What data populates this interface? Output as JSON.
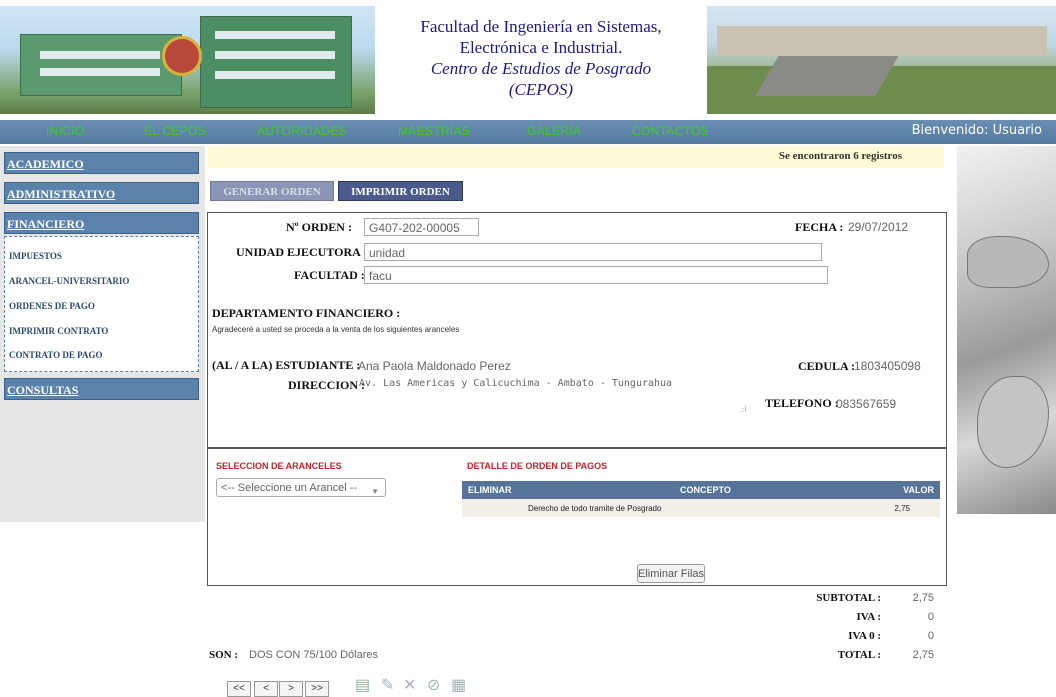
{
  "header": {
    "title_line1": "Facultad de Ingeniería en Sistemas,",
    "title_line2": "Electrónica e Industrial.",
    "title_line3": "Centro de Estudios de Posgrado",
    "title_line4": "(CEPOS)"
  },
  "nav": {
    "items": [
      "INICIO",
      "EL CEPOS",
      "AUTORIDADES",
      "MAESTRÍAS",
      "GALERÍA",
      "CONTACTOS"
    ],
    "welcome": "Bienvenido: Usuario",
    "item_color": "#3bd11f"
  },
  "sidebar": {
    "sections": [
      "ACADEMICO",
      "ADMINISTRATIVO",
      "FINANCIERO",
      "CONSULTAS"
    ],
    "financiero_items": [
      "IMPUESTOS",
      "ARANCEL-UNIVERSITARIO",
      "ORDENES DE PAGO",
      "IMPRIMIR CONTRATO",
      "CONTRATO DE PAGO"
    ]
  },
  "banner": {
    "text": "Se encontraron 6 registros"
  },
  "actions": {
    "generar": "GENERAR ORDEN",
    "imprimir": "IMPRIMIR ORDEN"
  },
  "order": {
    "orden_label": "Nº ORDEN :",
    "orden_value": "G407-202-00005",
    "fecha_label": "FECHA :",
    "fecha_value": "29/07/2012",
    "unidad_label": "UNIDAD EJECUTORA :",
    "unidad_value": "unidad",
    "facultad_label": "FACULTAD :",
    "facultad_value": "facu",
    "dept_label": "DEPARTAMENTO FINANCIERO :",
    "dept_text": "Agradeceré a usted se proceda a la venta de los siguientes aranceles",
    "estudiante_label": "(AL / A LA) ESTUDIANTE :",
    "estudiante_value": "Ana Paola Maldonado Perez",
    "cedula_label": "CEDULA :",
    "cedula_value": "1803405098",
    "direccion_label": "DIRECCION :",
    "direccion_value": "Av. Las Americas y Calicuchima - Ambato - Tungurahua",
    "telefono_label": "TELEFONO :",
    "telefono_value": "083567659"
  },
  "aranceles": {
    "seleccion_title": "SELECCION DE ARANCELES",
    "select_placeholder": "<-- Seleccione un Arancel --",
    "detalle_title": "DETALLE DE ORDEN DE PAGOS",
    "columns": [
      "ELIMINAR",
      "CONCEPTO",
      "VALOR"
    ],
    "rows": [
      {
        "concepto": "Derecho de todo tramite de Posgrado",
        "valor": "2,75"
      }
    ],
    "eliminar_button": "Eliminar Filas"
  },
  "totals": {
    "subtotal_label": "SUBTOTAL :",
    "subtotal_value": "2,75",
    "iva_label": "IVA :",
    "iva_value": "0",
    "iva0_label": "IVA 0 :",
    "iva0_value": "0",
    "total_label": "TOTAL :",
    "total_value": "2,75",
    "son_label": "SON :",
    "son_value": "DOS CON 75/100 Dólares"
  },
  "pager": {
    "first": "<<",
    "prev": "<",
    "next": ">",
    "last": ">>"
  },
  "toolbar_icons": [
    "new-document-icon",
    "edit-icon",
    "delete-icon",
    "cancel-icon",
    "print-icon"
  ]
}
